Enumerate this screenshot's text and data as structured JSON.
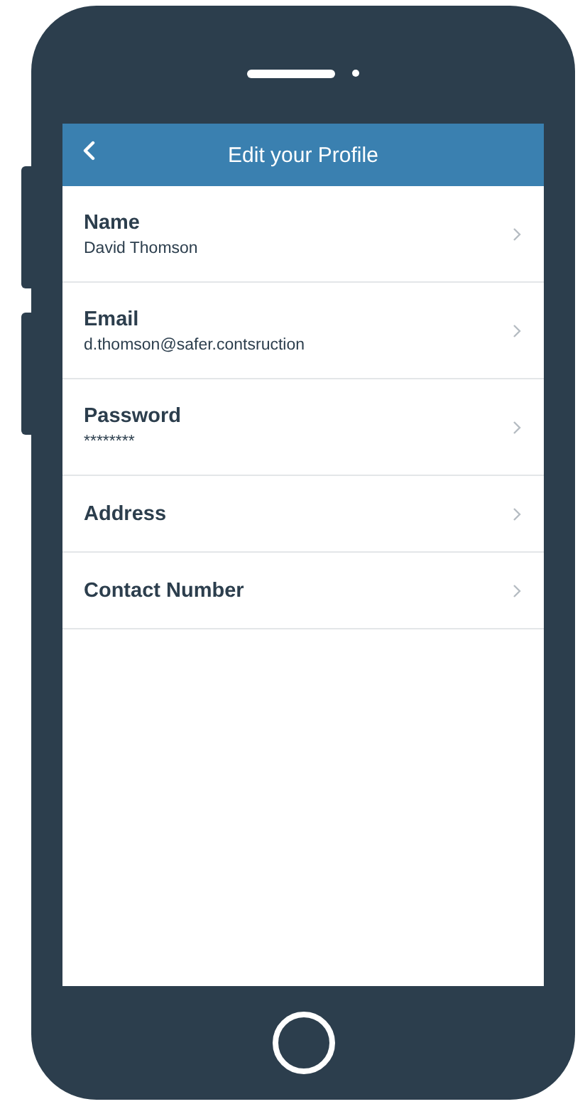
{
  "header": {
    "title": "Edit your Profile"
  },
  "rows": [
    {
      "label": "Name",
      "value": "David Thomson"
    },
    {
      "label": "Email",
      "value": "d.thomson@safer.contsruction"
    },
    {
      "label": "Password",
      "value": "********"
    },
    {
      "label": "Address"
    },
    {
      "label": "Contact Number"
    }
  ]
}
